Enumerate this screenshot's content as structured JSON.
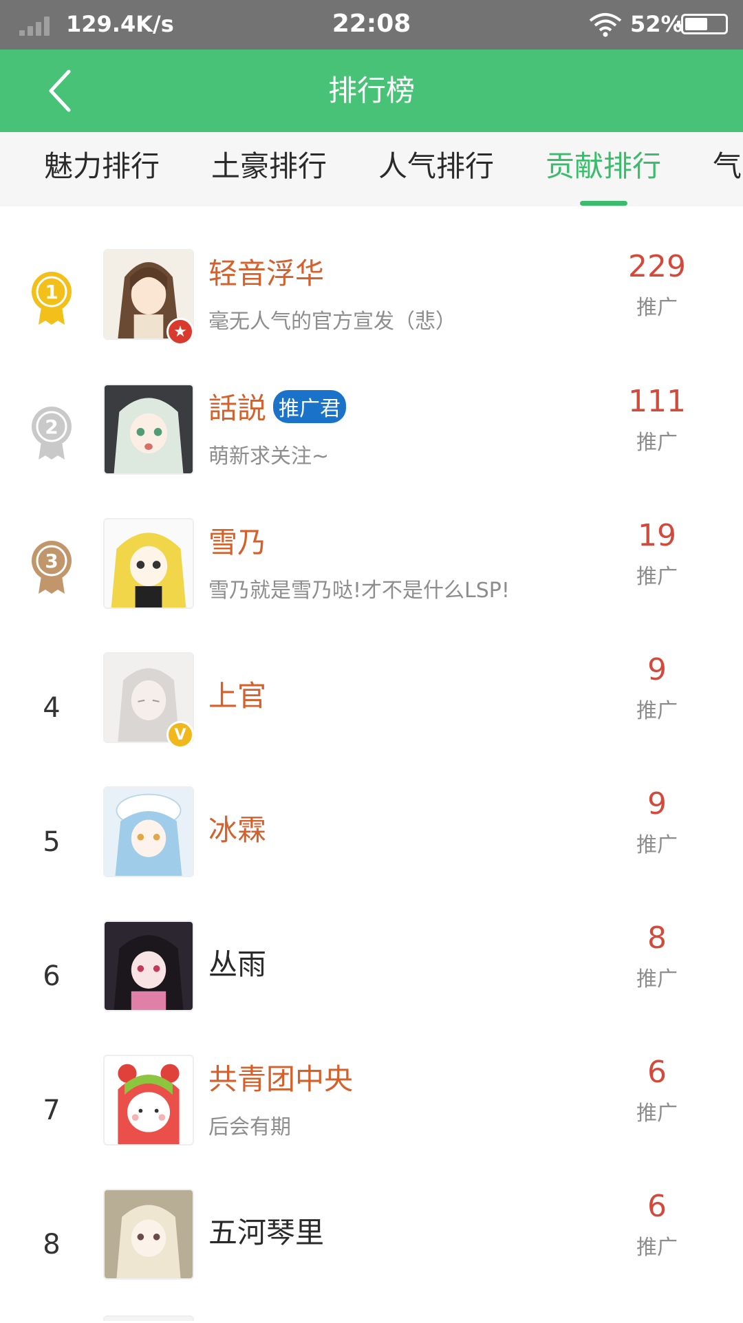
{
  "status_bar": {
    "speed": "129.4K/s",
    "time": "22:08",
    "battery_pct": "52%",
    "battery_level": 0.52
  },
  "header": {
    "title": "排行榜",
    "back_icon": "chevron-left-icon"
  },
  "tabs": [
    {
      "label": "魅力排行",
      "active": false
    },
    {
      "label": "土豪排行",
      "active": false
    },
    {
      "label": "人气排行",
      "active": false
    },
    {
      "label": "贡献排行",
      "active": true
    },
    {
      "label": "气",
      "active": false
    }
  ],
  "colors": {
    "accent": "#47c276",
    "name_highlight": "#d4602c",
    "score": "#d24a3c",
    "gold": "#f2c019",
    "silver": "#c9c9c9",
    "bronze": "#c2966b"
  },
  "entries": [
    {
      "rank": "1",
      "medal": "1",
      "name": "轻音浮华",
      "motto": "毫无人气的官方宣发（悲）",
      "score": "229",
      "score_label": "推广",
      "highlight": true
    },
    {
      "rank": "2",
      "medal": "2",
      "name": "話説",
      "tag": "推广君",
      "motto": "萌新求关注~",
      "score": "111",
      "score_label": "推广",
      "highlight": true
    },
    {
      "rank": "3",
      "medal": "3",
      "name": "雪乃",
      "motto": "雪乃就是雪乃哒!才不是什么LSP!",
      "score": "19",
      "score_label": "推广",
      "highlight": true
    },
    {
      "rank": "4",
      "name": "上官",
      "score": "9",
      "score_label": "推广",
      "highlight": true
    },
    {
      "rank": "5",
      "name": "冰霖",
      "score": "9",
      "score_label": "推广",
      "highlight": true
    },
    {
      "rank": "6",
      "name": "丛雨",
      "score": "8",
      "score_label": "推广",
      "highlight": false
    },
    {
      "rank": "7",
      "name": "共青团中央",
      "motto": "后会有期",
      "score": "6",
      "score_label": "推广",
      "highlight": true
    },
    {
      "rank": "8",
      "name": "五河琴里",
      "score": "6",
      "score_label": "推广",
      "highlight": false
    }
  ]
}
